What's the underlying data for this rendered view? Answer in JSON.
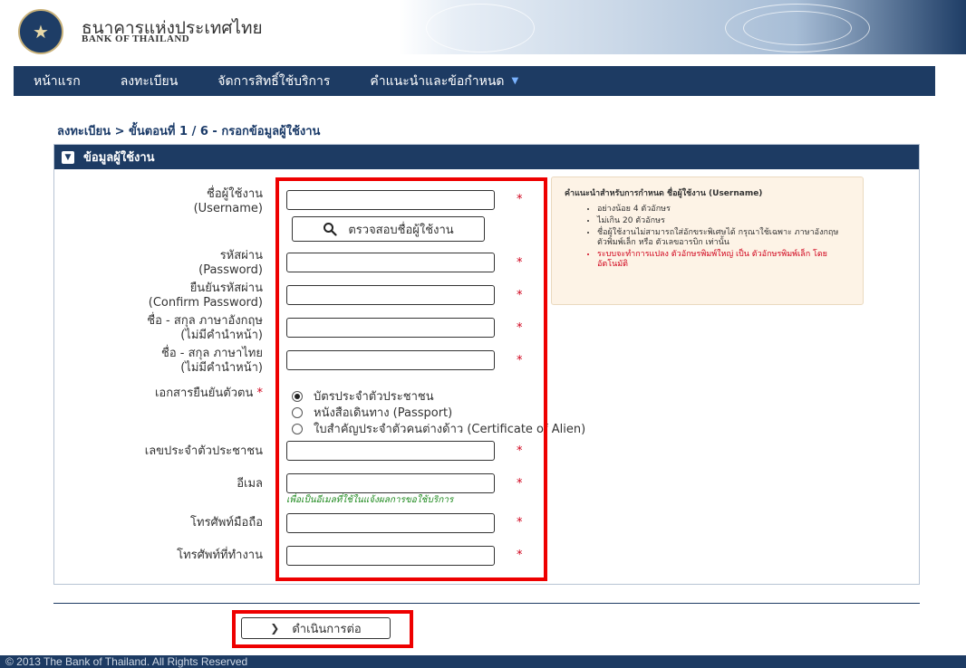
{
  "header": {
    "brand_th": "ธนาคารแห่งประเทศไทย",
    "brand_en": "BANK OF THAILAND"
  },
  "nav": {
    "items": [
      "หน้าแรก",
      "ลงทะเบียน",
      "จัดการสิทธิ์ใช้บริการ",
      "คำแนะนำและข้อกำหนด"
    ]
  },
  "breadcrumb": "ลงทะเบียน > ขั้นตอนที่ 1 / 6 - กรอกข้อมูลผู้ใช้งาน",
  "panel": {
    "title": "ข้อมูลผู้ใช้งาน"
  },
  "form": {
    "username_label_1": "ชื่อผู้ใช้งาน",
    "username_label_2": "(Username)",
    "check_button": "ตรวจสอบชื่อผู้ใช้งาน",
    "password_label_1": "รหัสผ่าน",
    "password_label_2": "(Password)",
    "confirm_label_1": "ยืนยันรหัสผ่าน",
    "confirm_label_2": "(Confirm Password)",
    "name_en_label_1": "ชื่อ - สกุล ภาษาอังกฤษ",
    "name_en_label_2": "(ไม่มีคำนำหน้า)",
    "name_th_label_1": "ชื่อ - สกุล ภาษาไทย",
    "name_th_label_2": "(ไม่มีคำนำหน้า)",
    "doc_label": "เอกสารยืนยันตัวตน",
    "doc_options": [
      "บัตรประจำตัวประชาชน",
      "หนังสือเดินทาง (Passport)",
      "ใบสำคัญประจำตัวคนต่างด้าว (Certificate of Alien)"
    ],
    "doc_selected": "บัตรประจำตัวประชาชน",
    "id_label": "เลขประจำตัวประชาชน",
    "email_label": "อีเมล",
    "email_hint": "เพื่อเป็นอีเมลที่ใช้ในแจ้งผลการขอใช้บริการ",
    "mobile_label": "โทรศัพท์มือถือ",
    "office_label": "โทรศัพท์ที่ทำงาน",
    "required_mark": "*"
  },
  "help": {
    "title": "คำแนะนำสำหรับการกำหนด ชื่อผู้ใช้งาน (Username)",
    "items": [
      "อย่างน้อย 4 ตัวอักษร",
      "ไม่เกิน 20 ตัวอักษร",
      "ชื่อผู้ใช้งานไม่สามารถใส่อักขระพิเศษได้ กรุณาใช้เฉพาะ ภาษาอังกฤษ ตัวพิมพ์เล็ก หรือ ตัวเลขอารบิก เท่านั้น",
      "ระบบจะทำการแปลง ตัวอักษรพิมพ์ใหญ่ เป็น ตัวอักษรพิมพ์เล็ก โดยอัตโนมัติ"
    ]
  },
  "continue_button": "ดำเนินการต่อ",
  "footer": "© 2013 The Bank of Thailand. All Rights Reserved",
  "colors": {
    "primary": "#1d3b63",
    "required": "#d0021b",
    "highlight": "#ee0000",
    "hint": "#1f8a1f",
    "help_bg": "#fdf3e6"
  }
}
